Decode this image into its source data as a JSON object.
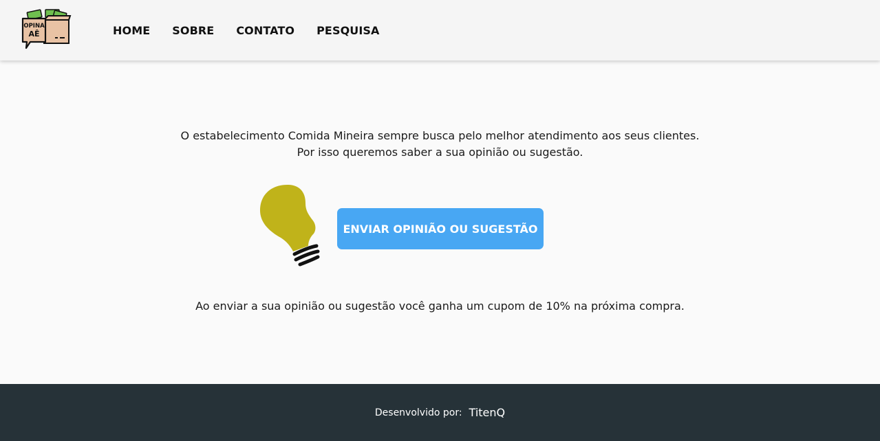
{
  "header": {
    "logo_text_line1": "OPINA",
    "logo_text_line2": "AÊ",
    "nav": [
      {
        "label": "HOME"
      },
      {
        "label": "SOBRE"
      },
      {
        "label": "CONTATO"
      },
      {
        "label": "PESQUISA"
      }
    ]
  },
  "main": {
    "intro_line1": "O estabelecimento Comida Mineira sempre busca pelo melhor atendimento aos seus clientes.",
    "intro_line2": "Por isso queremos saber a sua opinião ou sugestão.",
    "cta_label": "ENVIAR OPINIÃO OU SUGESTÃO",
    "note": "Ao enviar a sua opinião ou sugestão você ganha um cupom de 10% na próxima compra.",
    "icon": "lightbulb-icon"
  },
  "footer": {
    "label": "Desenvolvido por:",
    "author": "TitenQ"
  },
  "colors": {
    "header_bg": "#f5f5f5",
    "page_bg": "#fafafa",
    "cta_bg": "#48a7f3",
    "bulb": "#c0b31a",
    "footer_bg": "#263238"
  }
}
